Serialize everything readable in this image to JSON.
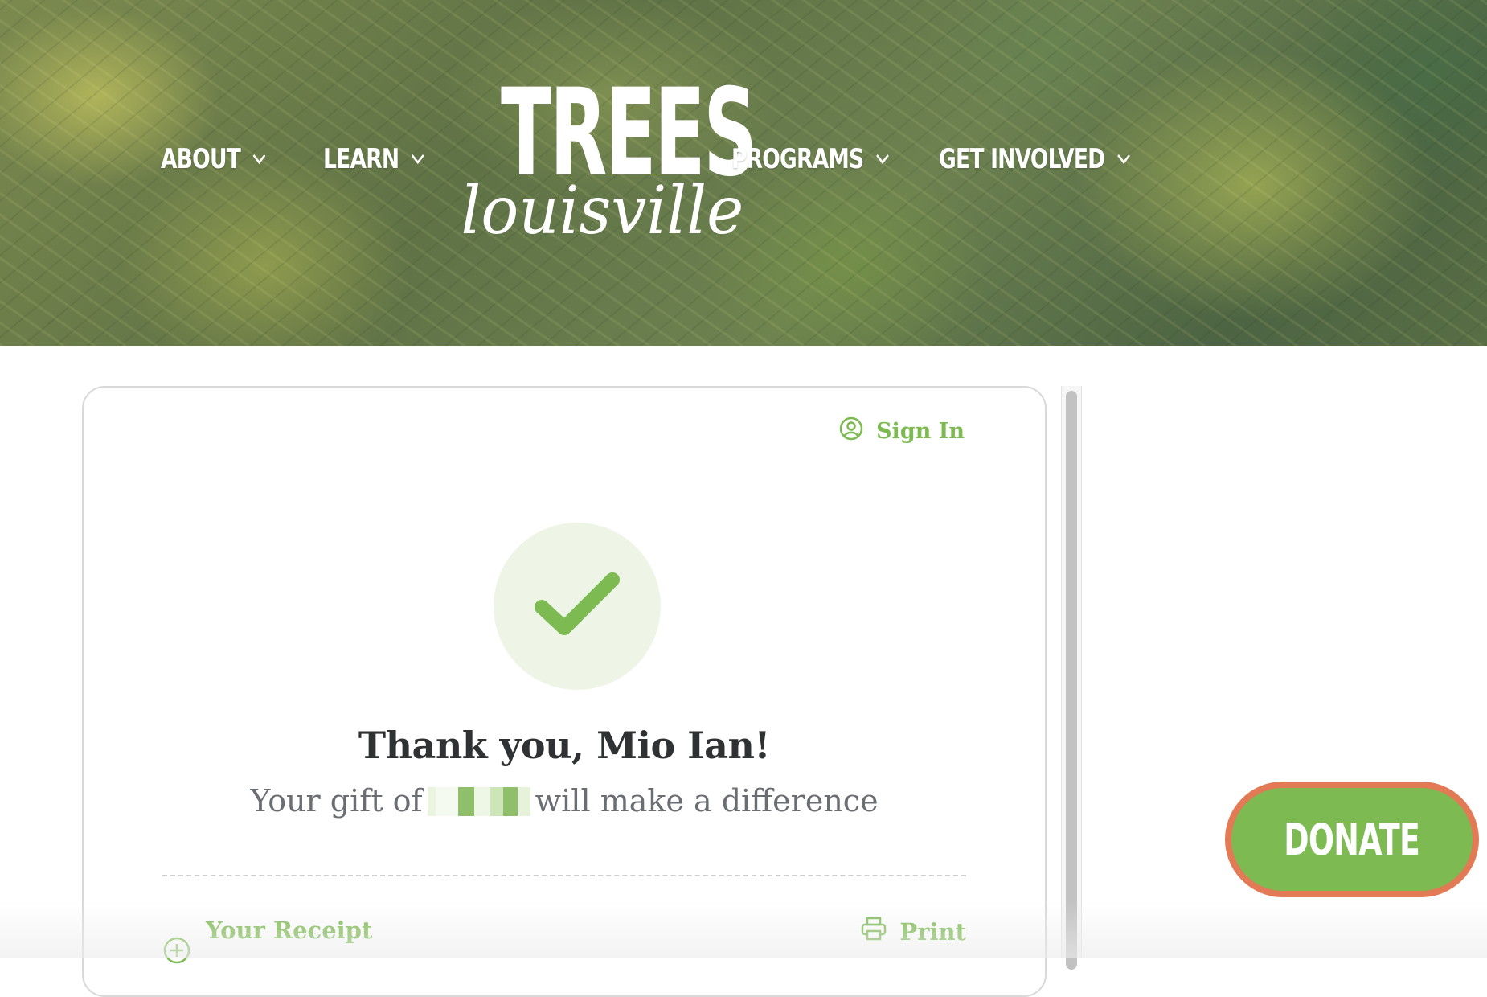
{
  "nav": {
    "items": [
      {
        "label": "ABOUT",
        "icon": "chevron-down-icon"
      },
      {
        "label": "LEARN",
        "icon": "chevron-down-icon"
      },
      {
        "label": "PROGRAMS",
        "icon": "chevron-down-icon"
      },
      {
        "label": "GET INVOLVED",
        "icon": "chevron-down-icon"
      }
    ]
  },
  "logo": {
    "main": "TREES",
    "sub": "louisville"
  },
  "card": {
    "sign_in": "Sign In",
    "thanks": "Thank you, Mio Ian!",
    "gift_prefix": "Your gift of",
    "gift_suffix": "will make a difference",
    "receipt": "Your Receipt",
    "print": "Print"
  },
  "donate": {
    "label": "DONATE"
  },
  "colors": {
    "accent_green": "#7dbb52",
    "donate_border": "#e17a55",
    "check_bg": "#eef5e7",
    "heading": "#2f3133",
    "body_text": "#6a6e73"
  }
}
